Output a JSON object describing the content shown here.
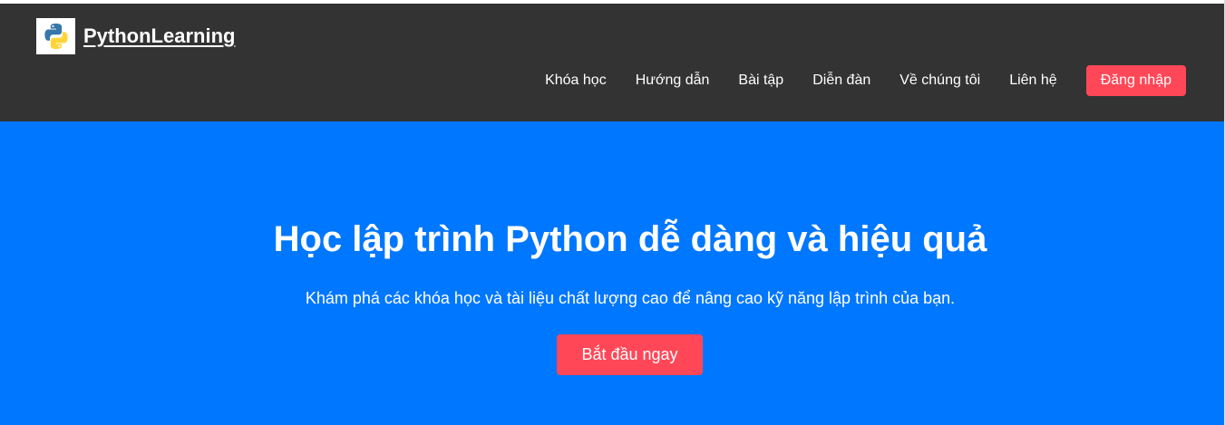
{
  "brand": {
    "name": "PythonLearning",
    "logo_icon": "python-logo-icon",
    "logo_colors": [
      "#3776ab",
      "#ffd43b"
    ]
  },
  "nav": {
    "items": [
      {
        "label": "Khóa học"
      },
      {
        "label": "Hướng dẫn"
      },
      {
        "label": "Bài tập"
      },
      {
        "label": "Diễn đàn"
      },
      {
        "label": "Về chúng tôi"
      },
      {
        "label": "Liên hệ"
      }
    ],
    "login_label": "Đăng nhập"
  },
  "hero": {
    "title": "Học lập trình Python dễ dàng và hiệu quả",
    "subtitle": "Khám phá các khóa học và tài liệu chất lượng cao để nâng cao kỹ năng lập trình của bạn.",
    "cta_label": "Bắt đầu ngay"
  },
  "colors": {
    "header_bg": "#333333",
    "hero_bg": "#0077ff",
    "accent": "#ff4757",
    "text": "#ffffff"
  }
}
